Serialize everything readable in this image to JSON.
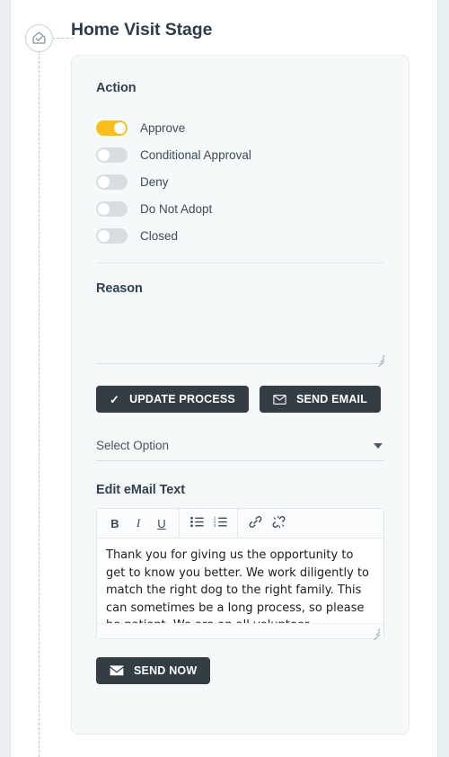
{
  "header": {
    "title": "Home Visit Stage",
    "stage_icon": "home-check-icon"
  },
  "card": {
    "action": {
      "label": "Action",
      "options": [
        {
          "label": "Approve",
          "enabled": true
        },
        {
          "label": "Conditional Approval",
          "enabled": false
        },
        {
          "label": "Deny",
          "enabled": false
        },
        {
          "label": "Do Not Adopt",
          "enabled": false
        },
        {
          "label": "Closed",
          "enabled": false
        }
      ]
    },
    "reason": {
      "label": "Reason",
      "value": "",
      "placeholder": ""
    },
    "actions": {
      "update_process": {
        "label": "UPDATE PROCESS",
        "icon": "check-icon"
      },
      "send_email": {
        "label": "SEND EMAIL",
        "icon": "envelope-outline-icon"
      }
    },
    "template_select": {
      "value": "Select Option",
      "caret_icon": "chevron-down-icon"
    },
    "editor": {
      "label": "Edit eMail Text",
      "toolbar": [
        {
          "name": "bold-button",
          "glyph": "B"
        },
        {
          "name": "italic-button",
          "glyph": "I"
        },
        {
          "name": "underline-button",
          "glyph": "U"
        },
        {
          "name": "bullet-list-button",
          "glyph": "list-ul-icon"
        },
        {
          "name": "numbered-list-button",
          "glyph": "list-ol-icon"
        },
        {
          "name": "insert-link-button",
          "glyph": "link-icon"
        },
        {
          "name": "remove-link-button",
          "glyph": "unlink-icon"
        }
      ],
      "body_text": "Thank you for giving us the opportunity to get to know you better. We work diligently to match the right dog to the right family. This can sometimes be a long process, so please be patient. We are an all-volunteer"
    },
    "send_now": {
      "label": "SEND NOW",
      "icon": "envelope-solid-icon"
    }
  },
  "colors": {
    "accent_on": "#fbbc1e",
    "toggle_off": "#d7dde1",
    "button_dark": "#343c44",
    "card_bg": "#f5f9fa",
    "title_text": "#2e3c4b",
    "rail_bg": "#eaeff2"
  }
}
